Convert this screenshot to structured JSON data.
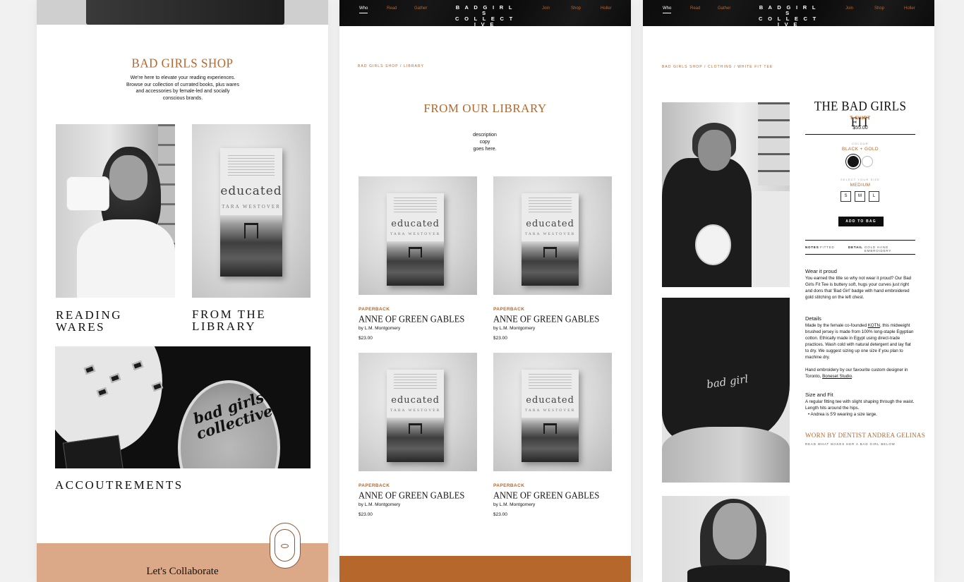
{
  "nav": {
    "items": [
      "Who",
      "Read",
      "Gather",
      "Join",
      "Shop",
      "Holler"
    ],
    "logo_line1": "B A D  G I R L S",
    "logo_line2": "C O L L E C T I V E"
  },
  "shop": {
    "title": "BAD GIRLS SHOP",
    "description": "We're here to elevate your reading experiences. Browse our collection of currated books, plus wares and accessories  by female-led and socially conscious brands.",
    "categories": [
      {
        "label_line1": "READING",
        "label_line2": "WARES"
      },
      {
        "label_line1": "FROM THE",
        "label_line2": "LIBRARY"
      },
      {
        "label_line1": "ACCOUTREMENTS"
      }
    ],
    "collaborate": "Let's Collaborate",
    "patch_text": "bad girls collective"
  },
  "book_cover": {
    "title": "educated",
    "author": "TARA WESTOVER"
  },
  "library": {
    "breadcrumb": "BAD GIRLS SHOP  /  LIBRARY",
    "title": "FROM OUR LIBRARY",
    "description_line1": "description",
    "description_line2": "copy",
    "description_line3": "goes here.",
    "products": [
      {
        "format": "PAPERBACK",
        "name": "ANNE OF GREEN GABLES",
        "author": "by L.M. Montgomery",
        "price": "$23.00"
      },
      {
        "format": "PAPERBACK",
        "name": "ANNE OF GREEN GABLES",
        "author": "by L.M. Montgomery",
        "price": "$23.00"
      },
      {
        "format": "PAPERBACK",
        "name": "ANNE OF GREEN GABLES",
        "author": "by L.M. Montgomery",
        "price": "$23.00"
      },
      {
        "format": "PAPERBACK",
        "name": "ANNE OF GREEN GABLES",
        "author": "by L.M. Montgomery",
        "price": "$23.00"
      }
    ]
  },
  "product": {
    "breadcrumb": "BAD GIRLS SHOP  /  CLOTHING  /  WHITE FIT TEE",
    "title": "THE BAD GIRLS FIT",
    "type": "T-SHIRT",
    "price": "$55.00",
    "colour_label": "COLOUR",
    "colour_value": "BLACK + GOLD",
    "size_label": "SELECT YOUR SIZE",
    "size_value": "MEDIUM",
    "sizes": [
      "S",
      "M",
      "L"
    ],
    "add_to_bag": "ADD TO BAG",
    "tabs": {
      "notes_label": "NOTES",
      "notes_value": "FITTED",
      "detail_label": "DETAIL",
      "detail_value": "GOLD  HAND  EMBROIDERY"
    },
    "wear_heading": "Wear it proud",
    "wear_text": "You earned the title so why not wear it proud? Our Bad Girls Fit Tee is buttery soft, hugs your curves just right and dons that 'Bad Girl' badge with hand embroidered gold stitching on the left chest.",
    "details_heading": "Details",
    "details_text_a": "Made by the female co-founded ",
    "details_link": "KOTN",
    "details_text_b": ", this midweight brushed jersey is made from 100% long-staple Egyptian cotton. Ethically made in Egypt using direct-trade practices. Wash cold with natural detergent and lay flat to dry. We suggest sizing up one size if you plan to machine dry.",
    "embroidery_text": "Hand embroidery by our favourite custom designer in Toronto, ",
    "embroidery_link": "Boneset Studio",
    "embroidery_end": ".",
    "size_heading": "Size and Fit",
    "size_text": "A regular fitting tee with slight shaping through the waist. Length hits around the hips.",
    "size_bullet": "Andrea is 5'9 wearing a size large.",
    "worn_by": "WORN BY DENTIST ANDREA GELINAS",
    "worn_sub": "READ WHAT MAKES HER A BAD GIRL BELOW",
    "shirt_embroidery": "bad girl"
  },
  "colors": {
    "accent": "#b5672c",
    "collab_bg": "#dba987",
    "footer_bar": "#b5672c",
    "nav_bg": "#0e0e0e"
  },
  "icons": [
    "bad-girls-collective-seal-icon",
    "colour-swatch-black",
    "colour-swatch-white"
  ]
}
